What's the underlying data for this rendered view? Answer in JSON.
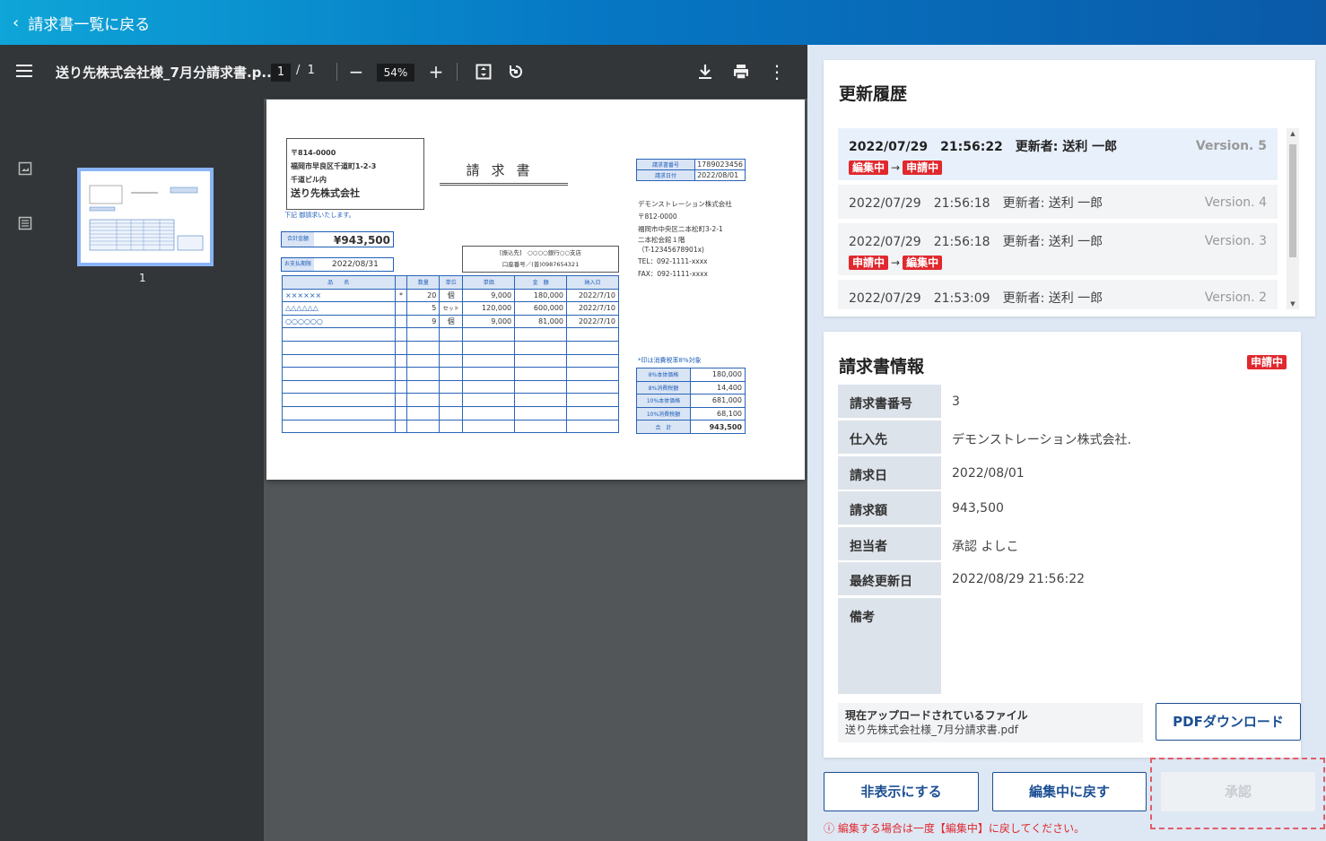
{
  "header": {
    "back_icon": "chevron-left-icon",
    "back_label": "請求書一覧に戻る"
  },
  "viewer": {
    "file_name": "送り先株式会社様_7月分請求書.p...",
    "page_current": "1",
    "page_sep": "/",
    "page_total": "1",
    "zoom": "54%",
    "thumb_page_number": "1"
  },
  "invoice": {
    "postal": "〒814-0000",
    "address1": "福岡市早良区千道町1-2-3",
    "address2": "千道ビル内",
    "recipient": "送り先株式会社",
    "title": "請求書",
    "note": "下記 御請求いたします。",
    "total_label": "合計金額",
    "total_value": "¥943,500",
    "due_label": "お支払期限",
    "due_value": "2022/08/31",
    "bank_line1": "[振込先]　○○○○銀行○○支店",
    "bank_line2": "口座番号／(普)0987654321",
    "meta": [
      {
        "k": "請求書番号",
        "v": "1789023456"
      },
      {
        "k": "請求日付",
        "v": "2022/08/01"
      }
    ],
    "company": [
      "デモンストレーション株式会社",
      "〒812-0000",
      "福岡市中央区二本松町3-2-1",
      "二本松会館１階",
      "（T-12345678901x)",
      "TEL：092-1111-xxxx",
      "FAX：092-1111-xxxx"
    ],
    "columns": [
      "品　　名",
      "",
      "数量",
      "単位",
      "単価",
      "金　額",
      "納入日"
    ],
    "rows": [
      [
        "××××××",
        "*",
        "20",
        "個",
        "9,000",
        "180,000",
        "2022/7/10"
      ],
      [
        "△△△△△△",
        "",
        "5",
        "セット",
        "120,000",
        "600,000",
        "2022/7/10"
      ],
      [
        "○○○○○○",
        "",
        "9",
        "個",
        "9,000",
        "81,000",
        "2022/7/10"
      ]
    ],
    "tax_note": "*印は消費税率8%対象",
    "totals": [
      {
        "k": "8%本体価格",
        "v": "180,000"
      },
      {
        "k": "8%消費税額",
        "v": "14,400"
      },
      {
        "k": "10%本体価格",
        "v": "681,000"
      },
      {
        "k": "10%消費税額",
        "v": "68,100"
      },
      {
        "k": "合　計",
        "v": "943,500"
      }
    ]
  },
  "history": {
    "title": "更新履歴",
    "entries": [
      {
        "text": "2022/07/29　21:56:22　更新者: 送利 一郎",
        "version": "Version. 5",
        "from": "編集中",
        "to": "申請中"
      },
      {
        "text": "2022/07/29　21:56:18　更新者: 送利 一郎",
        "version": "Version. 4"
      },
      {
        "text": "2022/07/29　21:56:18　更新者: 送利 一郎",
        "version": "Version. 3",
        "from": "申請中",
        "to": "編集中"
      },
      {
        "text": "2022/07/29　21:53:09　更新者: 送利 一郎",
        "version": "Version. 2"
      }
    ],
    "arrow": "→"
  },
  "info": {
    "title": "請求書情報",
    "status": "申請中",
    "fields": [
      {
        "k": "請求書番号",
        "v": "3"
      },
      {
        "k": "仕入先",
        "v": "デモンストレーション株式会社."
      },
      {
        "k": "請求日",
        "v": "2022/08/01"
      },
      {
        "k": "請求額",
        "v": "943,500"
      },
      {
        "k": "担当者",
        "v": "承認 よしこ"
      },
      {
        "k": "最終更新日",
        "v": "2022/08/29 21:56:22"
      },
      {
        "k": "備考",
        "v": ""
      }
    ],
    "file_label": "現在アップロードされているファイル",
    "file_name": "送り先株式会社様_7月分請求書.pdf",
    "download_label": "PDFダウンロード"
  },
  "actions": {
    "hide_label": "非表示にする",
    "revert_label": "編集中に戻す",
    "approve_label": "承認",
    "warning": "編集する場合は一度【編集中】に戻してください。"
  },
  "colors": {
    "accent": "#1c4f94",
    "danger": "#e0282e",
    "header_start": "#0ea5d8",
    "header_end": "#0a5aa8"
  }
}
